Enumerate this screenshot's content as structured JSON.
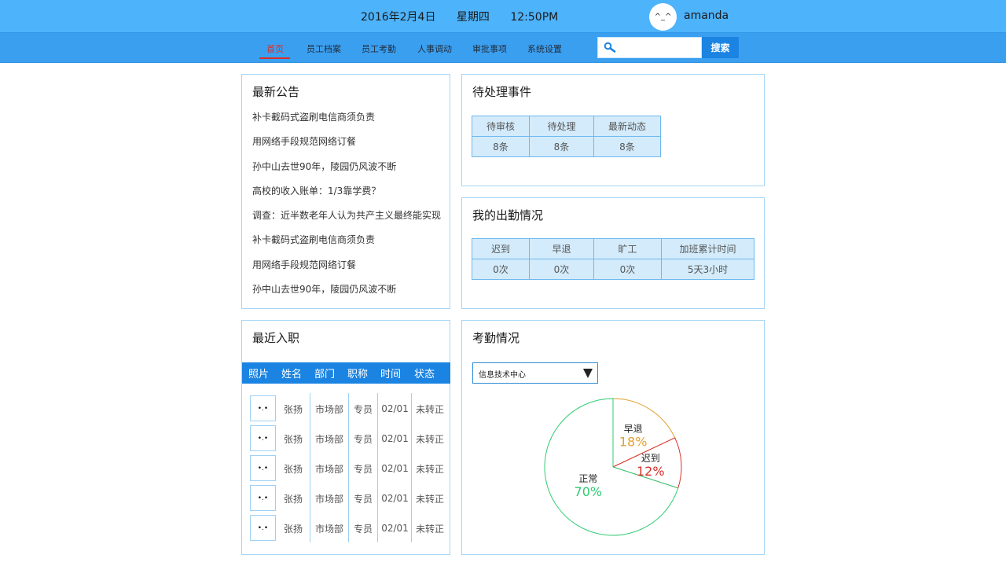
{
  "header": {
    "date": "2016年2月4日",
    "weekday": "星期四",
    "time": "12:50PM",
    "avatar_face": "^_^",
    "username": "amanda"
  },
  "nav": {
    "items": [
      "首页",
      "员工档案",
      "员工考勤",
      "人事调动",
      "审批事项",
      "系统设置"
    ],
    "active_index": 0,
    "search_placeholder": "",
    "search_button": "搜索"
  },
  "announcements": {
    "title": "最新公告",
    "items": [
      "补卡截码式盗刷电信商须负责",
      "用网络手段规范网络订餐",
      "孙中山去世90年，陵园仍风波不断",
      "高校的收入账单：1/3靠学费？",
      "调查：近半数老年人认为共产主义最终能实现",
      "补卡截码式盗刷电信商须负责",
      "用网络手段规范网络订餐",
      "孙中山去世90年，陵园仍风波不断"
    ]
  },
  "pending": {
    "title": "待处理事件",
    "headers": [
      "待审核",
      "待处理",
      "最新动态"
    ],
    "values": [
      "8条",
      "8条",
      "8条"
    ]
  },
  "attendance_mine": {
    "title": "我的出勤情况",
    "headers": [
      "迟到",
      "早退",
      "旷工",
      "加班累计时间"
    ],
    "values": [
      "0次",
      "0次",
      "0次",
      "5天3小时"
    ]
  },
  "new_hires": {
    "title": "最近入职",
    "headers": [
      "照片",
      "姓名",
      "部门",
      "职称",
      "时间",
      "状态"
    ],
    "rows": [
      {
        "photo": "•.•",
        "name": "张扬",
        "dept": "市场部",
        "title": "专员",
        "date": "02/01",
        "status": "未转正"
      },
      {
        "photo": "•.•",
        "name": "张扬",
        "dept": "市场部",
        "title": "专员",
        "date": "02/01",
        "status": "未转正"
      },
      {
        "photo": "•.•",
        "name": "张扬",
        "dept": "市场部",
        "title": "专员",
        "date": "02/01",
        "status": "未转正"
      },
      {
        "photo": "•.•",
        "name": "张扬",
        "dept": "市场部",
        "title": "专员",
        "date": "02/01",
        "status": "未转正"
      },
      {
        "photo": "•.•",
        "name": "张扬",
        "dept": "市场部",
        "title": "专员",
        "date": "02/01",
        "status": "未转正"
      }
    ]
  },
  "attendance_stats": {
    "title": "考勤情况",
    "department": "信息技术中心"
  },
  "chart_data": {
    "type": "pie",
    "title": "",
    "slices": [
      {
        "label": "正常",
        "value": 70,
        "display": "70%",
        "color": "#2ecc71"
      },
      {
        "label": "早退",
        "value": 18,
        "display": "18%",
        "color": "#e0a030"
      },
      {
        "label": "迟到",
        "value": 12,
        "display": "12%",
        "color": "#d9302b"
      }
    ]
  },
  "colors": {
    "top_bar": "#4db3fb",
    "nav_bar": "#3b9ff0",
    "accent": "#1b84e2",
    "active_nav": "#d9302b",
    "panel_border": "#a6d6f7"
  }
}
